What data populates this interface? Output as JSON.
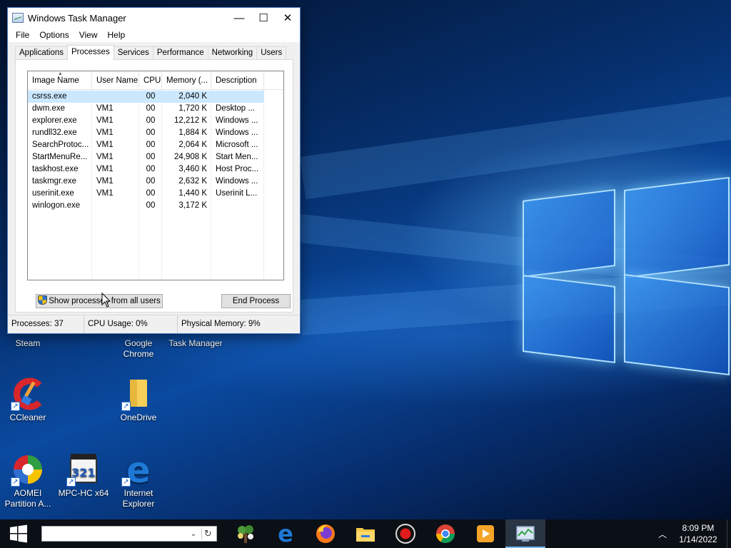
{
  "window": {
    "title": "Windows Task Manager",
    "controls": {
      "minimize": "—",
      "maximize": "☐",
      "close": "✕"
    },
    "menu": [
      "File",
      "Options",
      "View",
      "Help"
    ],
    "tabs": [
      {
        "label": "Applications",
        "active": false
      },
      {
        "label": "Processes",
        "active": true
      },
      {
        "label": "Services",
        "active": false
      },
      {
        "label": "Performance",
        "active": false
      },
      {
        "label": "Networking",
        "active": false
      },
      {
        "label": "Users",
        "active": false
      }
    ],
    "processes": {
      "columns": [
        "Image Name",
        "User Name",
        "CPU",
        "Memory (...",
        "Description"
      ],
      "rows": [
        {
          "image": "csrss.exe",
          "user": "",
          "cpu": "00",
          "memory": "2,040 K",
          "description": "",
          "selected": true
        },
        {
          "image": "dwm.exe",
          "user": "VM1",
          "cpu": "00",
          "memory": "1,720 K",
          "description": "Desktop ..."
        },
        {
          "image": "explorer.exe",
          "user": "VM1",
          "cpu": "00",
          "memory": "12,212 K",
          "description": "Windows ..."
        },
        {
          "image": "rundll32.exe",
          "user": "VM1",
          "cpu": "00",
          "memory": "1,884 K",
          "description": "Windows ..."
        },
        {
          "image": "SearchProtoc...",
          "user": "VM1",
          "cpu": "00",
          "memory": "2,064 K",
          "description": "Microsoft ..."
        },
        {
          "image": "StartMenuRe...",
          "user": "VM1",
          "cpu": "00",
          "memory": "24,908 K",
          "description": "Start Men..."
        },
        {
          "image": "taskhost.exe",
          "user": "VM1",
          "cpu": "00",
          "memory": "3,460 K",
          "description": "Host Proc..."
        },
        {
          "image": "taskmgr.exe",
          "user": "VM1",
          "cpu": "00",
          "memory": "2,632 K",
          "description": "Windows ..."
        },
        {
          "image": "userinit.exe",
          "user": "VM1",
          "cpu": "00",
          "memory": "1,440 K",
          "description": "Userinit L..."
        },
        {
          "image": "winlogon.exe",
          "user": "",
          "cpu": "00",
          "memory": "3,172 K",
          "description": ""
        }
      ]
    },
    "show_all_button": "Show processes from all users",
    "end_process_button": "End Process",
    "status": {
      "processes": "Processes: 37",
      "cpu": "CPU Usage: 0%",
      "memory": "Physical Memory: 9%"
    }
  },
  "desktop_icons": [
    {
      "label": "Steam",
      "icon": "steam-icon"
    },
    {
      "label": "Google Chrome",
      "icon": "chrome-icon"
    },
    {
      "label": "Task Manager",
      "icon": "task-manager-icon"
    },
    {
      "label": "CCleaner",
      "icon": "ccleaner-icon"
    },
    {
      "label": "OneDrive",
      "icon": "folder-icon"
    },
    {
      "label": "AOMEI Partition A...",
      "icon": "aomei-icon"
    },
    {
      "label": "MPC-HC x64",
      "icon": "mpc-hc-icon"
    },
    {
      "label": "Internet Explorer",
      "icon": "edge-icon"
    }
  ],
  "taskbar": {
    "apps": [
      "garden-app-icon",
      "edge-icon",
      "firefox-icon",
      "file-explorer-icon",
      "record-icon",
      "chrome-icon",
      "media-player-icon",
      "task-manager-icon"
    ],
    "active_app": "task-manager-icon",
    "time": "8:09 PM",
    "date": "1/14/2022",
    "search_dropdown": "⌄",
    "search_refresh": "↻"
  },
  "colors": {
    "selection": "#cce8ff",
    "taskbar": "#0b0f16",
    "window_border": "#4a7ec4"
  }
}
